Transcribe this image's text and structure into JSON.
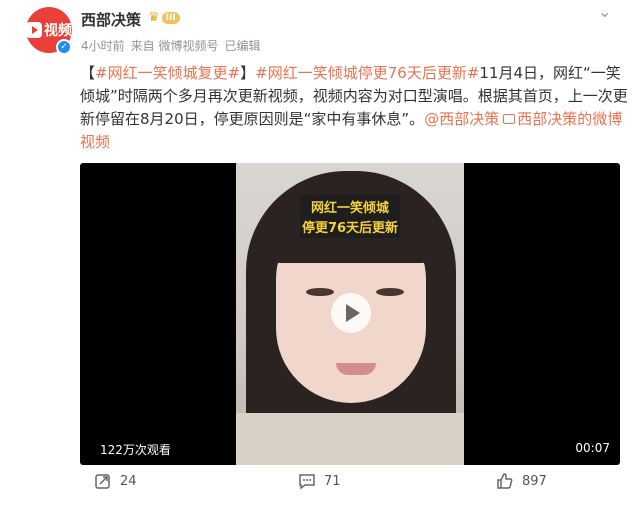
{
  "author": {
    "avatar_text": "视频",
    "name": "西部决策",
    "vip_level": "III"
  },
  "meta": {
    "time": "4小时前",
    "source": "来自 微博视频号",
    "status": "已编辑"
  },
  "post": {
    "open_bracket": "【",
    "tag1": "#网红一笑倾城复更#",
    "close_bracket": "】",
    "tag2": "#网红一笑倾城停更76天后更新#",
    "body": "11月4日，网红“一笑倾城”时隔两个多月再次更新视频，视频内容为对口型演唱。根据其首页，上一次更新停留在8月20日，停更原因则是“家中有事休息”。",
    "mention": "@西部决策",
    "video_link": "西部决策的微博视频"
  },
  "video": {
    "overlay_line1": "网红一笑倾城",
    "overlay_line2": "停更76天后更新",
    "views": "122万次观看",
    "duration": "00:07"
  },
  "actions": {
    "repost_count": "24",
    "comment_count": "71",
    "like_count": "897"
  },
  "colors": {
    "accent": "#eb7350",
    "verified": "#1e8df5",
    "avatar_bg": "#e9403a"
  }
}
